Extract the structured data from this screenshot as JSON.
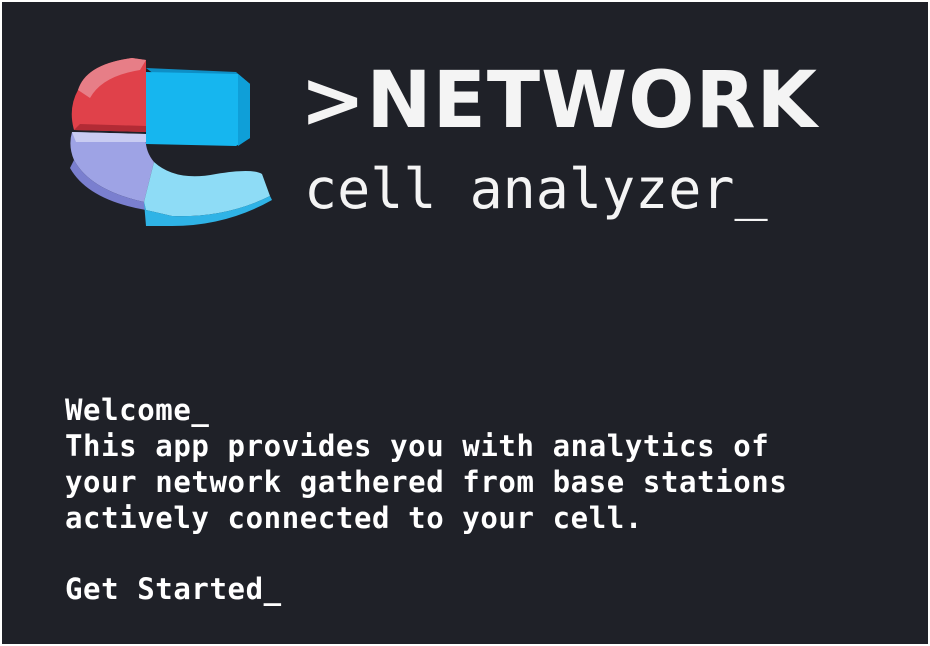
{
  "brand": {
    "title": ">NETWORK",
    "subtitle": "cell analyzer_",
    "logo_icon": "ring-logo-icon",
    "colors": {
      "background": "#1f2128",
      "red": "#d6393f",
      "blue": "#15b7f0",
      "light_blue": "#8fdcf5",
      "lavender": "#9fa5e3"
    }
  },
  "welcome": {
    "heading": "Welcome_",
    "lines": [
      "This app provides you with analytics of",
      "your network gathered from base stations",
      "actively connected to your cell."
    ]
  },
  "cta": {
    "label": "Get Started_"
  }
}
